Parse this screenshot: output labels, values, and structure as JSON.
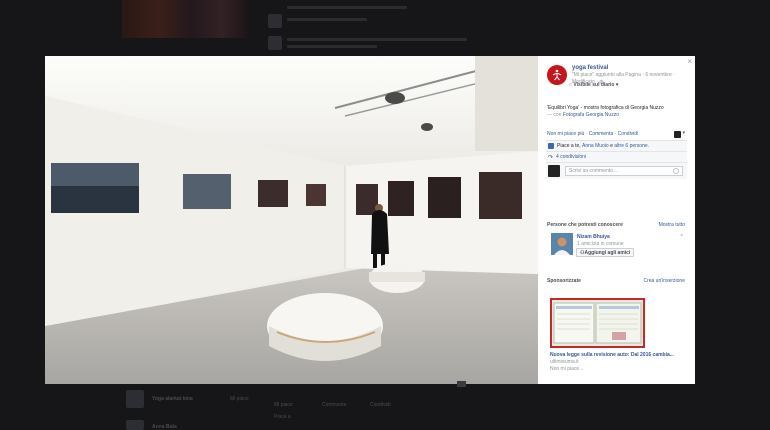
{
  "post": {
    "page_name": "yoga festival",
    "meta_line1": "\"Mi piace\" aggiunto alla Pagina · 6 novembre ·",
    "meta_line2": "Modificato · ",
    "visibility": "Visibile sul diario",
    "caption_title": "'Equilibri Yoga' - mostra fotografica di Georgia Nuzzo",
    "caption_with": "— con",
    "caption_tag": "Fotografa Georgia Nuzzo"
  },
  "actions": {
    "unlike": "Non mi piace più",
    "comment": "Commenta",
    "share": "Condividi"
  },
  "ufi": {
    "likes_prefix": "Piace a te,",
    "likes_person": "Anna Muoio",
    "likes_mid": "e",
    "likes_others": "altre 6 persone.",
    "shares": "4 condivisioni",
    "comment_placeholder": "Scrivi un commento..."
  },
  "pymk": {
    "title": "Persone che potresti conoscere",
    "see_all": "Mostra tutto",
    "name": "Nizam Bhuiya",
    "mutual": "1 amicizia in comune",
    "add_button": "Aggiungi agli amici",
    "dismiss": "×"
  },
  "sponsored": {
    "title": "Sponsorizzate",
    "create": "Crea un'inserzione",
    "ad_title": "Nuova legge sulla revisione auto: Dal 2016 cambia...",
    "ad_domain": "ultimissima.it",
    "ad_dislike": "Non mi piace..."
  },
  "background_page": {
    "left_names": [
      "Yoga alarkat kina",
      "Anna Bata"
    ],
    "actions": [
      "Mi piace",
      "Commenta",
      "Condividi"
    ],
    "bottom_label": "Piace a"
  },
  "close_symbol": "×",
  "colors": {
    "accent": "#365899",
    "brand": "#c4161c",
    "like": "#4267b2"
  }
}
